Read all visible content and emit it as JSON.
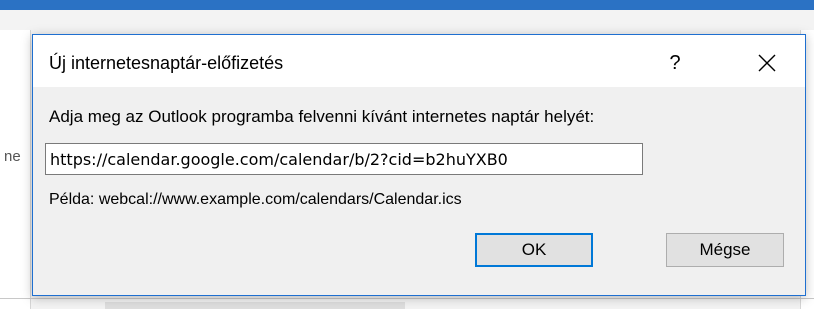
{
  "background": {
    "edge_text": "ne"
  },
  "dialog": {
    "title": "Új internetesnaptár-előfizetés",
    "help_label": "?",
    "close_icon": "close-icon",
    "prompt": "Adja meg az Outlook programba felvenni kívánt internetes naptár helyét:",
    "url_value": "https://calendar.google.com/calendar/b/2?cid=b2huYXB0",
    "example": "Példa: webcal://www.example.com/calendars/Calendar.ics",
    "ok_label": "OK",
    "cancel_label": "Mégse",
    "accent_color": "#0078d7"
  }
}
